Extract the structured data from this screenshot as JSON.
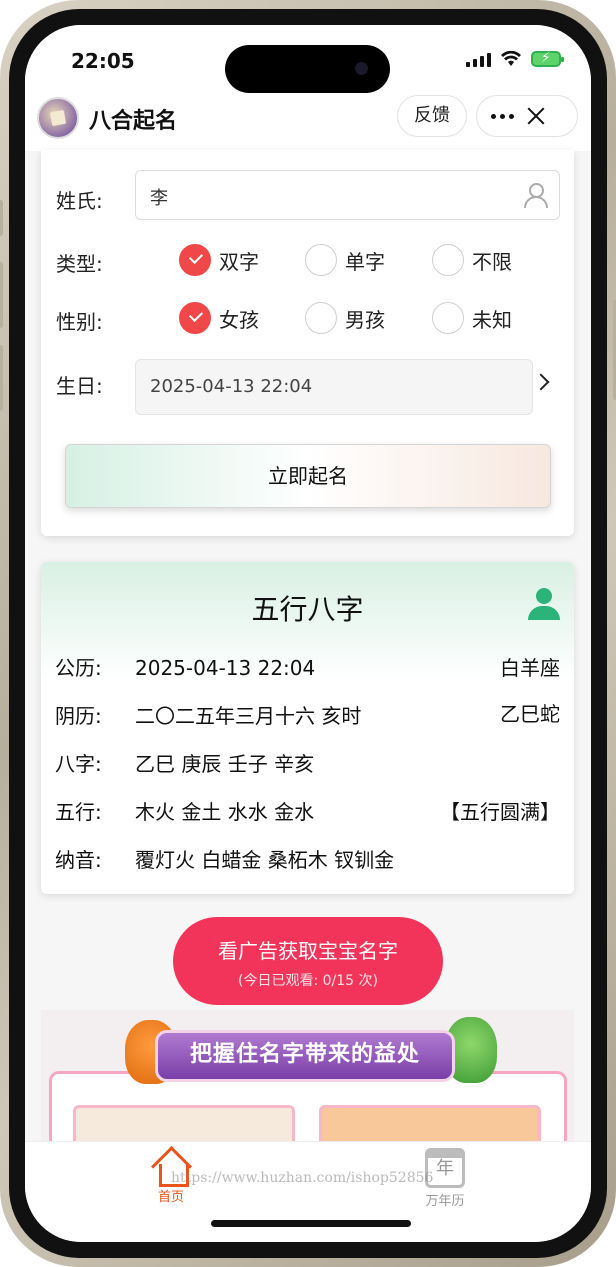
{
  "status": {
    "time": "22:05"
  },
  "app": {
    "title": "八合起名",
    "feedback": "反馈"
  },
  "form": {
    "surname_label": "姓氏:",
    "surname_value": "李",
    "type_label": "类型:",
    "type_options": [
      "双字",
      "单字",
      "不限"
    ],
    "type_selected": "双字",
    "gender_label": "性别:",
    "gender_options": [
      "女孩",
      "男孩",
      "未知"
    ],
    "gender_selected": "女孩",
    "birthday_label": "生日:",
    "birthday_value": "2025-04-13 22:04",
    "submit": "立即起名"
  },
  "bazi": {
    "title": "五行八字",
    "rows": [
      {
        "label": "公历:",
        "value": "2025-04-13 22:04",
        "extra": "白羊座"
      },
      {
        "label": "阴历:",
        "value": "二〇二五年三月十六 亥时",
        "extra": "乙巳蛇"
      },
      {
        "label": "八字:",
        "value": "乙巳 庚辰 壬子 辛亥",
        "extra": ""
      },
      {
        "label": "五行:",
        "value": "木火 金土 水水 金水",
        "extra": "【五行圆满】"
      },
      {
        "label": "纳音:",
        "value": "覆灯火 白蜡金 桑柘木 钗钏金",
        "extra": ""
      }
    ]
  },
  "ad": {
    "label": "看广告获取宝宝名字",
    "sub": "(今日已观看: 0/15 次)"
  },
  "benefit": {
    "banner": "把握住名字带来的益处"
  },
  "tabbar": {
    "home": "首页",
    "calendar": "万年历",
    "calendar_glyph": "年"
  },
  "watermark": "https://www.huzhan.com/ishop52856",
  "colors": {
    "accent": "#f04848",
    "ad": "#f2345a",
    "home_active": "#e8541b",
    "bazi_green": "#2bb37a"
  }
}
